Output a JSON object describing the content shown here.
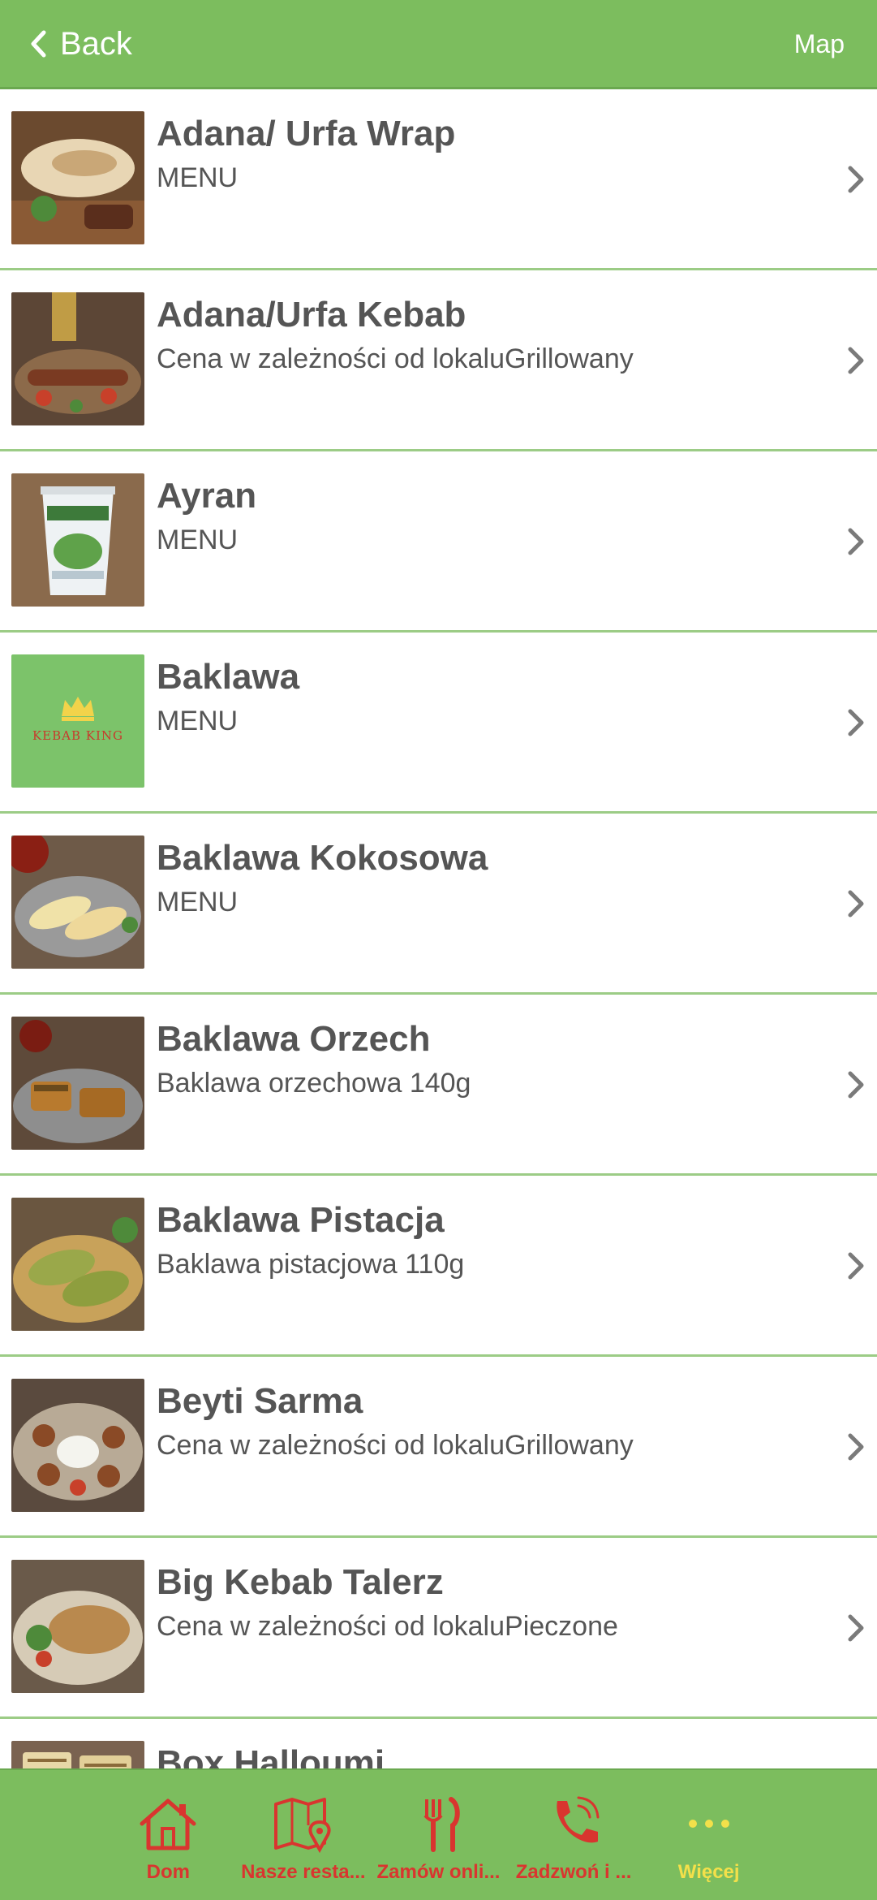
{
  "nav": {
    "back_label": "Back",
    "map_label": "Map"
  },
  "items": [
    {
      "title": "Adana/ Urfa Wrap",
      "subtitle": "MENU"
    },
    {
      "title": "Adana/Urfa Kebab",
      "subtitle": "Cena w zależności od lokaluGrillowany"
    },
    {
      "title": "Ayran",
      "subtitle": "MENU"
    },
    {
      "title": "Baklawa",
      "subtitle": "MENU",
      "logo_text": "KEBAB KING"
    },
    {
      "title": "Baklawa Kokosowa",
      "subtitle": "MENU"
    },
    {
      "title": "Baklawa Orzech",
      "subtitle": "Baklawa orzechowa 140g"
    },
    {
      "title": "Baklawa Pistacja",
      "subtitle": "Baklawa pistacjowa 110g"
    },
    {
      "title": "Beyti Sarma",
      "subtitle": "Cena w zależności od lokaluGrillowany"
    },
    {
      "title": "Big Kebab Talerz",
      "subtitle": "Cena w zależności od lokaluPieczone"
    },
    {
      "title": "Box Halloumi",
      "subtitle": ""
    }
  ],
  "tabbar": {
    "tabs": [
      {
        "label": "Dom",
        "icon": "home-icon"
      },
      {
        "label": "Nasze resta...",
        "icon": "map-pin-icon"
      },
      {
        "label": "Zamów onli...",
        "icon": "fork-knife-icon"
      },
      {
        "label": "Zadzwoń i ...",
        "icon": "phone-icon"
      },
      {
        "label": "Więcej",
        "icon": "more-dots-icon"
      }
    ]
  },
  "colors": {
    "nav_green": "#7cbd5e",
    "divider": "#9ccc86",
    "tab_red": "#d9352f",
    "tab_more_yellow": "#f3e04a",
    "text": "#555555"
  }
}
